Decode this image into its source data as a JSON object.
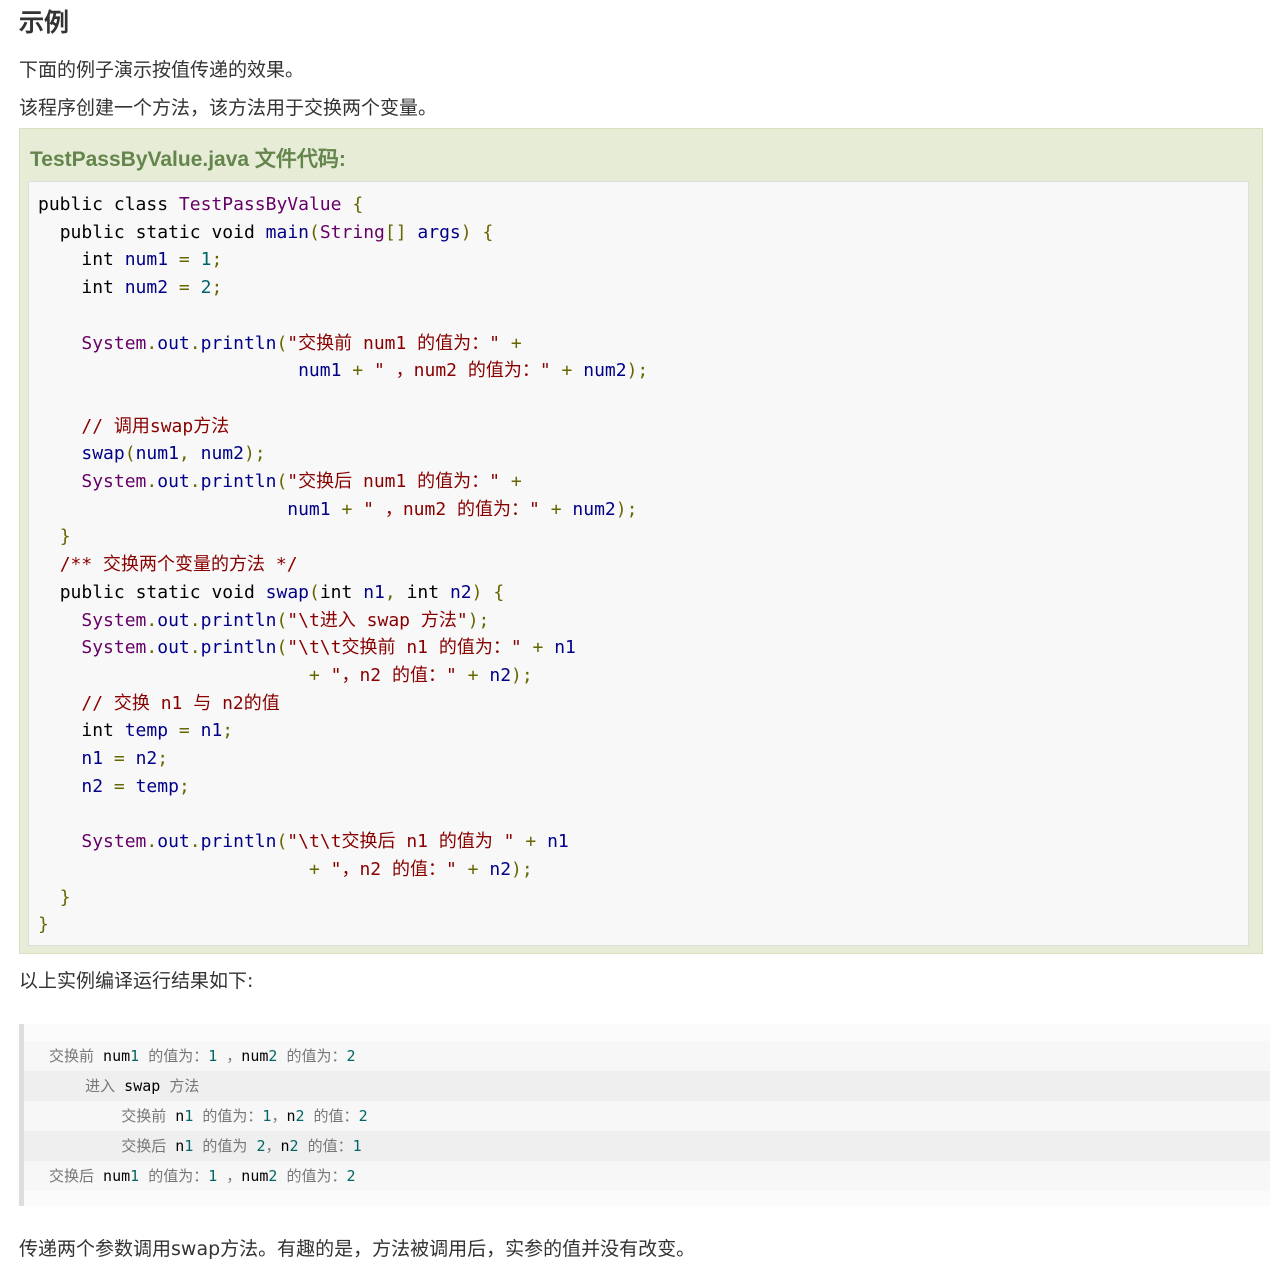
{
  "heading": "示例",
  "intro": [
    "下面的例子演示按值传递的效果。",
    "该程序创建一个方法，该方法用于交换两个变量。"
  ],
  "example": {
    "title": "TestPassByValue.java 文件代码:",
    "code_lines": [
      "public class TestPassByValue {",
      "  public static void main(String[] args) {",
      "    int num1 = 1;",
      "    int num2 = 2;",
      "",
      "    System.out.println(\"交换前 num1 的值为：\" +",
      "                        num1 + \" ，num2 的值为：\" + num2);",
      "",
      "    // 调用swap方法",
      "    swap(num1, num2);",
      "    System.out.println(\"交换后 num1 的值为：\" +",
      "                       num1 + \" ，num2 的值为：\" + num2);",
      "  }",
      "  /** 交换两个变量的方法 */",
      "  public static void swap(int n1, int n2) {",
      "    System.out.println(\"\\t进入 swap 方法\");",
      "    System.out.println(\"\\t\\t交换前 n1 的值为：\" + n1",
      "                         + \"，n2 的值：\" + n2);",
      "    // 交换 n1 与 n2的值",
      "    int temp = n1;",
      "    n1 = n2;",
      "    n2 = temp;",
      "",
      "    System.out.println(\"\\t\\t交换后 n1 的值为 \" + n1",
      "                         + \"，n2 的值：\" + n2);",
      "  }",
      "}"
    ]
  },
  "result_label": "以上实例编译运行结果如下:",
  "output_lines": [
    "交换前 num1 的值为：1 ，num2 的值为：2",
    "    进入 swap 方法",
    "        交换前 n1 的值为：1，n2 的值：2",
    "        交换后 n1 的值为 2，n2 的值：1",
    "交换后 num1 的值为：1 ，num2 的值为：2"
  ],
  "conclusion": "传递两个参数调用swap方法。有趣的是，方法被调用后，实参的值并没有改变。"
}
